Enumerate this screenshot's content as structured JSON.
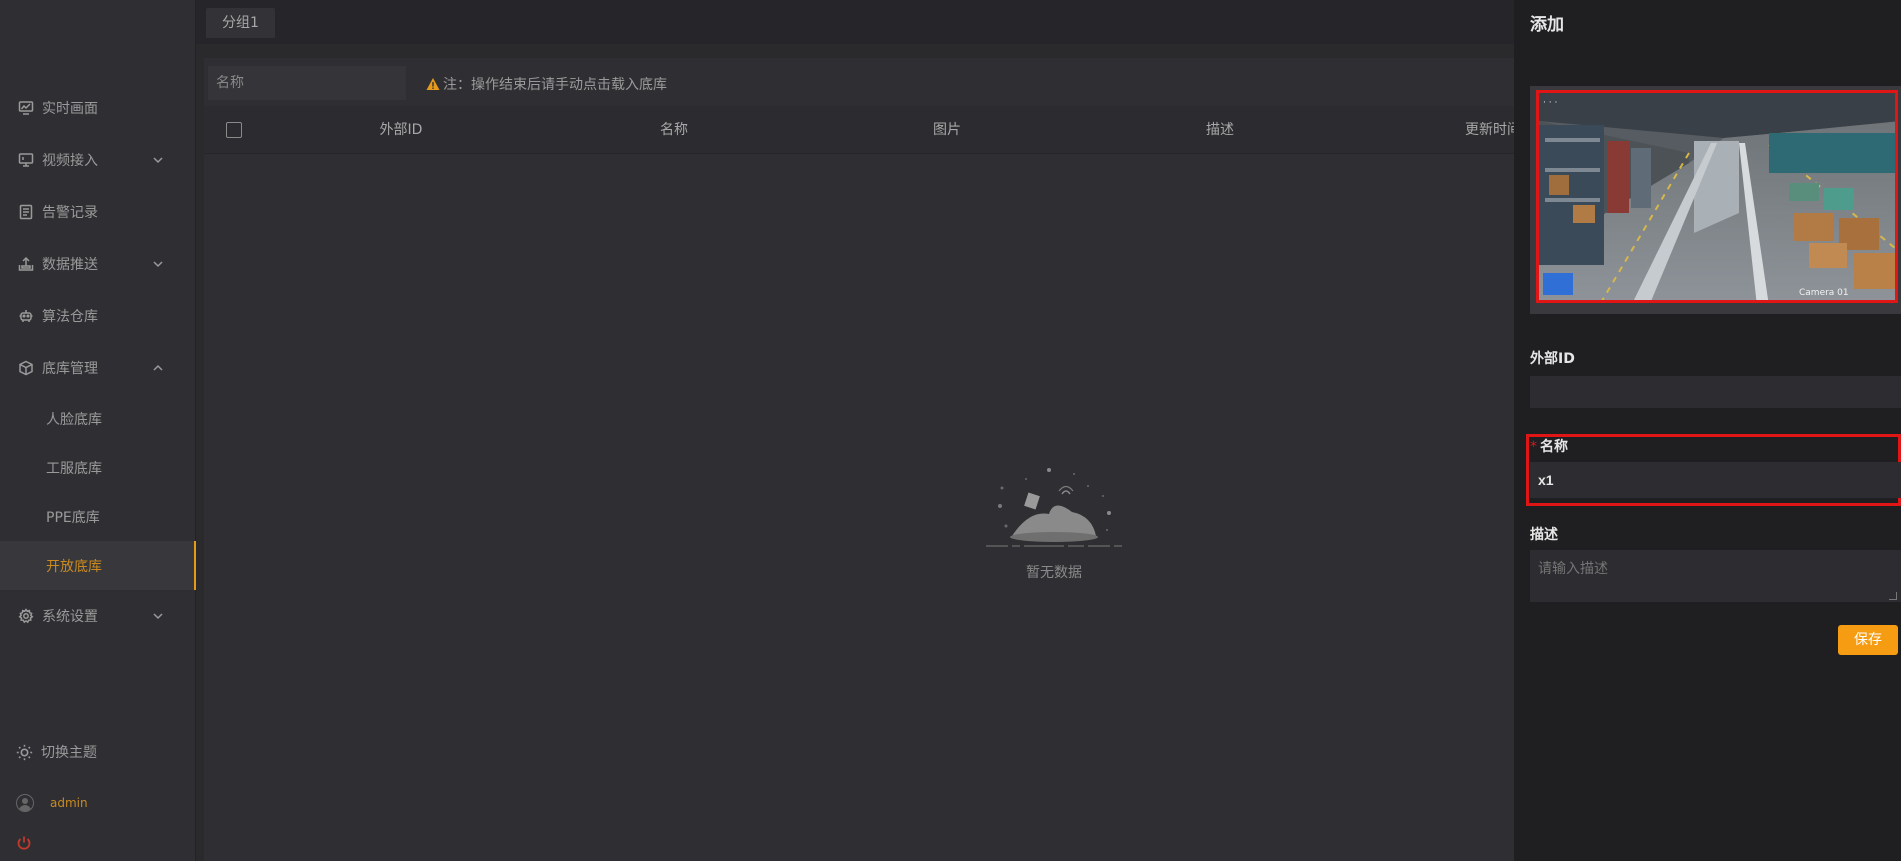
{
  "sidebar": {
    "items": [
      {
        "label": "实时画面",
        "icon": "monitor-chart-icon",
        "has_chevron": false
      },
      {
        "label": "视频接入",
        "icon": "video-input-icon",
        "has_chevron": true
      },
      {
        "label": "告警记录",
        "icon": "document-icon",
        "has_chevron": false
      },
      {
        "label": "数据推送",
        "icon": "upload-icon",
        "has_chevron": true
      },
      {
        "label": "算法仓库",
        "icon": "robot-icon",
        "has_chevron": false
      },
      {
        "label": "底库管理",
        "icon": "cube-icon",
        "has_chevron": true,
        "expanded": true
      }
    ],
    "sub_items": [
      {
        "label": "人脸底库"
      },
      {
        "label": "工服底库"
      },
      {
        "label": "PPE底库"
      },
      {
        "label": "开放底库",
        "active": true
      }
    ],
    "settings": {
      "label": "系统设置",
      "icon": "gear-icon"
    },
    "theme_label": "切换主题",
    "user": "admin"
  },
  "main": {
    "tab": "分组1",
    "search_placeholder": "名称",
    "note": "注：操作结束后请手动点击载入底库",
    "columns": [
      "外部ID",
      "名称",
      "图片",
      "描述",
      "更新时间"
    ],
    "empty_text": "暂无数据"
  },
  "panel": {
    "title": "添加",
    "external_id_label": "外部ID",
    "external_id_value": "",
    "name_label": "名称",
    "name_value": "x1",
    "desc_label": "描述",
    "desc_placeholder": "请输入描述",
    "save_label": "保存",
    "image_overlay_text": "Camera 01"
  },
  "colors": {
    "accent": "#f59c12",
    "active_text": "#c98a1f",
    "highlight": "#e01515"
  }
}
